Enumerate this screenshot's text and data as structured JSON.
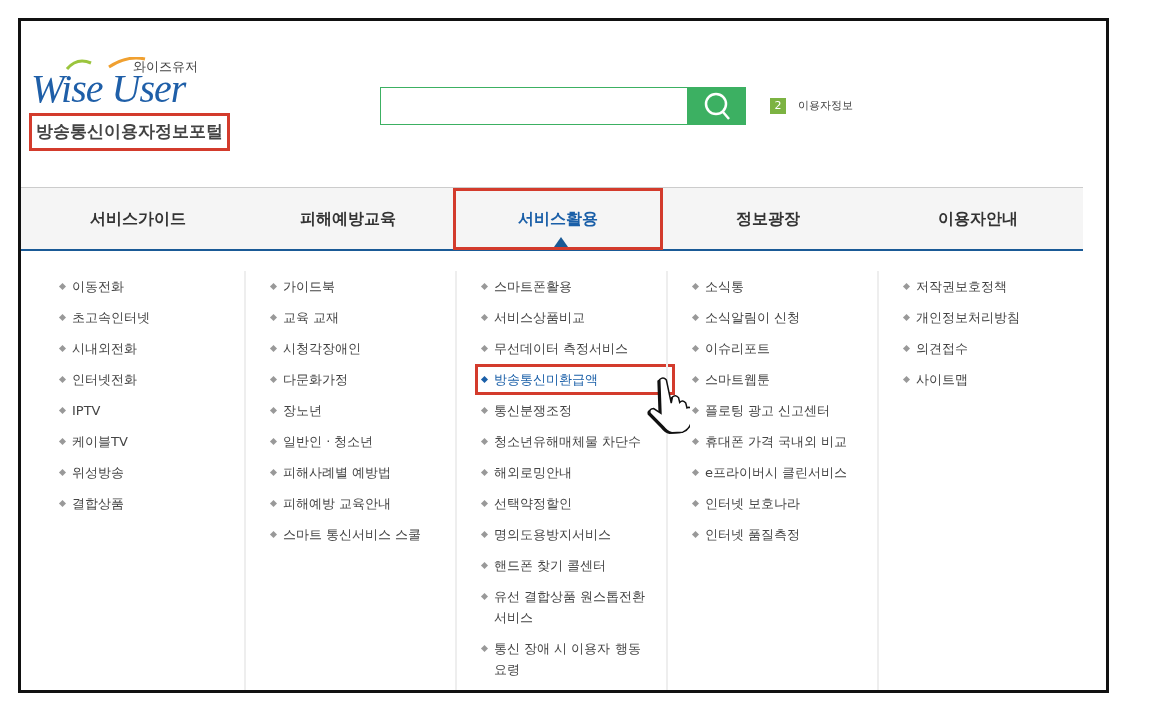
{
  "logo": {
    "subtitle": "와이즈유저",
    "title": "Wise User"
  },
  "tagline": {
    "text": "방송통신이용자정보포털",
    "annotated": true
  },
  "user_info": {
    "badge": "2",
    "label": "이용자정보"
  },
  "nav_tabs": [
    {
      "label": "서비스가이드",
      "selected": false
    },
    {
      "label": "피해예방교육",
      "selected": false
    },
    {
      "label": "서비스활용",
      "selected": true
    },
    {
      "label": "정보광장",
      "selected": false
    },
    {
      "label": "이용자안내",
      "selected": false
    }
  ],
  "menu_columns": [
    {
      "items": [
        {
          "text": "이동전화",
          "selected": false
        },
        {
          "text": "초고속인터넷",
          "selected": false
        },
        {
          "text": "시내외전화",
          "selected": false
        },
        {
          "text": "인터넷전화",
          "selected": false
        },
        {
          "text": "IPTV",
          "selected": false
        },
        {
          "text": "케이블TV",
          "selected": false
        },
        {
          "text": "위성방송",
          "selected": false
        },
        {
          "text": "결합상품",
          "selected": false
        }
      ]
    },
    {
      "items": [
        {
          "text": "가이드북",
          "selected": false
        },
        {
          "text": "교육 교재",
          "selected": false
        },
        {
          "text": "시청각장애인",
          "selected": false
        },
        {
          "text": "다문화가정",
          "selected": false
        },
        {
          "text": "장노년",
          "selected": false
        },
        {
          "text": "일반인 · 청소년",
          "selected": false
        },
        {
          "text": "피해사례별 예방법",
          "selected": false
        },
        {
          "text": "피해예방 교육안내",
          "selected": false
        },
        {
          "text": "스마트 통신서비스 스쿨",
          "selected": false
        }
      ]
    },
    {
      "items": [
        {
          "text": "스마트폰활용",
          "selected": false
        },
        {
          "text": "서비스상품비교",
          "selected": false
        },
        {
          "text": "무선데이터 측정서비스",
          "selected": false
        },
        {
          "text": "방송통신미환급액",
          "selected": true
        },
        {
          "text": "통신분쟁조정",
          "selected": false
        },
        {
          "text": "청소년유해매체물 차단수",
          "selected": false
        },
        {
          "text": "해외로밍안내",
          "selected": false
        },
        {
          "text": "선택약정할인",
          "selected": false
        },
        {
          "text": "명의도용방지서비스",
          "selected": false
        },
        {
          "text": "핸드폰 찾기 콜센터",
          "selected": false
        },
        {
          "text": "유선 결합상품 원스톱전환 서비스",
          "selected": false
        },
        {
          "text": "통신 장애 시 이용자 행동요령",
          "selected": false
        }
      ]
    },
    {
      "items": [
        {
          "text": "소식통",
          "selected": false
        },
        {
          "text": "소식알림이 신청",
          "selected": false
        },
        {
          "text": "이슈리포트",
          "selected": false
        },
        {
          "text": "스마트웹툰",
          "selected": false
        },
        {
          "text": "플로팅 광고 신고센터",
          "selected": false
        },
        {
          "text": "휴대폰 가격 국내외 비교",
          "selected": false
        },
        {
          "text": "e프라이버시 클린서비스",
          "selected": false
        },
        {
          "text": "인터넷 보호나라",
          "selected": false
        },
        {
          "text": "인터넷 품질측정",
          "selected": false
        }
      ]
    },
    {
      "items": [
        {
          "text": "저작권보호정책",
          "selected": false
        },
        {
          "text": "개인정보처리방침",
          "selected": false
        },
        {
          "text": "의견접수",
          "selected": false
        },
        {
          "text": "사이트맵",
          "selected": false
        }
      ]
    }
  ]
}
